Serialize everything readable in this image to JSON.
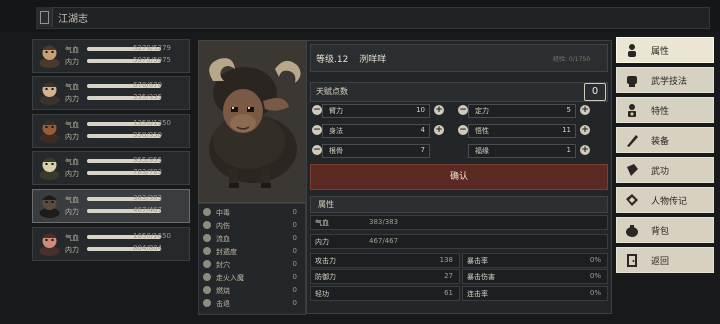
{
  "header": {
    "title": "江湖志"
  },
  "team": [
    {
      "qi": "5279/5279",
      "neili": "5975/5975",
      "qi_frac": 1.0,
      "neili_frac": 1.0
    },
    {
      "qi": "670/670",
      "neili": "335/335",
      "qi_frac": 1.0,
      "neili_frac": 1.0
    },
    {
      "qi": "1350/1350",
      "neili": "950/950",
      "qi_frac": 1.0,
      "neili_frac": 1.0
    },
    {
      "qi": "955/955",
      "neili": "783/783",
      "qi_frac": 1.0,
      "neili_frac": 1.0
    },
    {
      "qi": "383/383",
      "neili": "467/467",
      "qi_frac": 1.0,
      "neili_frac": 1.0
    },
    {
      "qi": "1650/1650",
      "neili": "804/804",
      "qi_frac": 1.0,
      "neili_frac": 1.0
    }
  ],
  "labels": {
    "qi": "气血",
    "neili": "内力"
  },
  "status_list": [
    {
      "label": "中毒",
      "value": "0"
    },
    {
      "label": "内伤",
      "value": "0"
    },
    {
      "label": "流血",
      "value": "0"
    },
    {
      "label": "封遁度",
      "value": "0"
    },
    {
      "label": "封穴",
      "value": "0"
    },
    {
      "label": "走火入魔",
      "value": "0"
    },
    {
      "label": "燃烧",
      "value": "0"
    },
    {
      "label": "击退",
      "value": "0"
    }
  ],
  "character": {
    "level_text": "等级.12",
    "name": "洌咩咩",
    "exp": "经验: 0/1750"
  },
  "points": {
    "label": "天赋点数",
    "value": "0"
  },
  "attributes": [
    {
      "label": "臂力",
      "value": "10"
    },
    {
      "label": "定力",
      "value": "5"
    },
    {
      "label": "身法",
      "value": "4"
    },
    {
      "label": "悟性",
      "value": "11"
    },
    {
      "label": "根骨",
      "value": "7"
    },
    {
      "label": "福缘",
      "value": "1"
    }
  ],
  "confirm_label": "确认",
  "properties": {
    "title": "属性",
    "qi_label": "气血",
    "qi_value": "383/383",
    "neili_label": "内力",
    "neili_value": "467/467",
    "grid": [
      {
        "label": "攻击力",
        "value": "138"
      },
      {
        "label": "暴击率",
        "value": "0%"
      },
      {
        "label": "防御力",
        "value": "27"
      },
      {
        "label": "暴击伤害",
        "value": "0%"
      },
      {
        "label": "轻功",
        "value": "61"
      },
      {
        "label": "连击率",
        "value": "0%"
      }
    ]
  },
  "menu": [
    {
      "label": "属性",
      "icon": "person-icon"
    },
    {
      "label": "武学技法",
      "icon": "fist-icon"
    },
    {
      "label": "特性",
      "icon": "trait-icon"
    },
    {
      "label": "装备",
      "icon": "sword-icon"
    },
    {
      "label": "武功",
      "icon": "book-icon"
    },
    {
      "label": "人物传记",
      "icon": "scroll-icon"
    },
    {
      "label": "背包",
      "icon": "bag-icon"
    },
    {
      "label": "返回",
      "icon": "exit-icon"
    }
  ],
  "colors": {
    "accent_confirm": "#5a2a22",
    "menu_bg": "#d6d1c0",
    "bar_fill": "#d7d3c6"
  }
}
